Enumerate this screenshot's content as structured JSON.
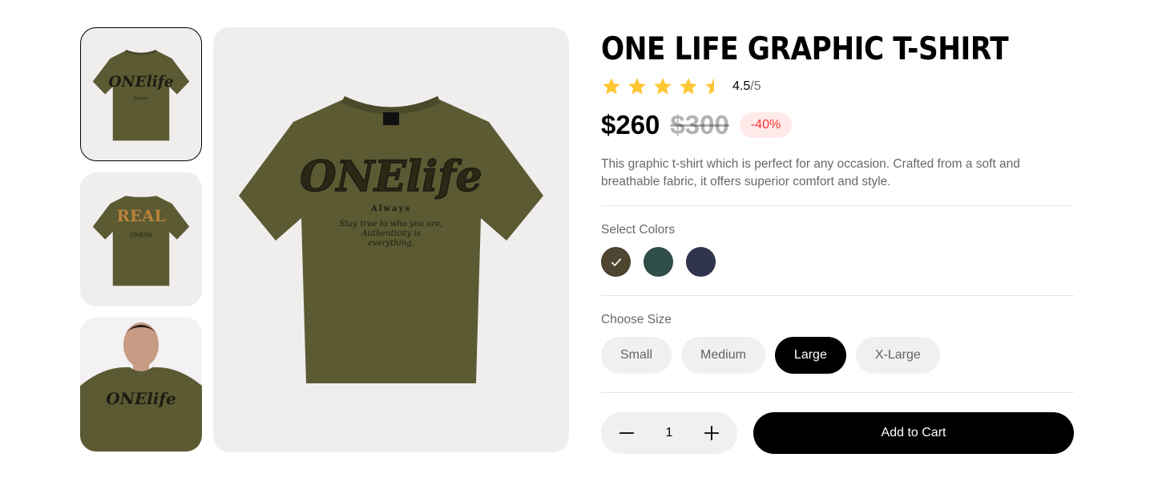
{
  "product": {
    "title": "ONE LIFE GRAPHIC T-SHIRT",
    "rating_value": "4.5",
    "rating_max": "/5",
    "stars": 4.5,
    "price": "$260",
    "old_price": "$300",
    "discount": "-40%",
    "description": "This graphic t-shirt which is perfect for any occasion. Crafted from a soft and breathable fabric, it offers superior comfort and style."
  },
  "gallery": {
    "thumbnails": [
      {
        "name": "thumbnail-front",
        "selected": true
      },
      {
        "name": "thumbnail-back",
        "selected": false
      },
      {
        "name": "thumbnail-model",
        "selected": false
      }
    ],
    "main_image": "tshirt-front-image"
  },
  "colors": {
    "label": "Select Colors",
    "options": [
      {
        "hex": "#4f4631",
        "selected": true
      },
      {
        "hex": "#314f4a",
        "selected": false
      },
      {
        "hex": "#31344f",
        "selected": false
      }
    ]
  },
  "sizes": {
    "label": "Choose Size",
    "options": [
      {
        "label": "Small",
        "selected": false
      },
      {
        "label": "Medium",
        "selected": false
      },
      {
        "label": "Large",
        "selected": true
      },
      {
        "label": "X-Large",
        "selected": false
      }
    ]
  },
  "cart": {
    "quantity": "1",
    "add_label": "Add to Cart",
    "minus_icon": "minus-icon",
    "plus_icon": "plus-icon"
  },
  "theme": {
    "star_color": "#ffc633",
    "shirt_color": "#5b5a33",
    "discount_color": "#ff3333"
  }
}
